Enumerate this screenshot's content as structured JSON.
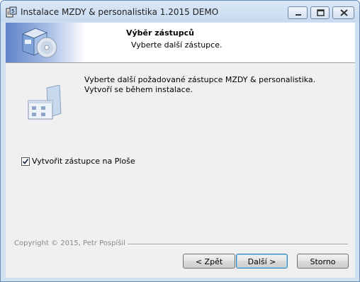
{
  "window": {
    "title": "Instalace MZDY & personalistika 1.2015 DEMO"
  },
  "header": {
    "title": "Výběr zástupců",
    "subtitle": "Vyberte další zástupce."
  },
  "body": {
    "description": "Vyberte další požadované zástupce MZDY & personalistika. Vytvoří se během instalace.",
    "checkbox": {
      "label": "Vytvořit zástupce na Ploše",
      "checked": true
    }
  },
  "footer": {
    "copyright": "Copyright © 2015, Petr Pospíšil",
    "buttons": {
      "back": "< Zpět",
      "next": "Další >",
      "cancel": "Storno"
    }
  },
  "icons": [
    "installer-app-icon",
    "minimize-icon",
    "maximize-icon",
    "close-icon",
    "installer-box-icon",
    "shortcut-folder-icon",
    "checkmark-icon"
  ]
}
